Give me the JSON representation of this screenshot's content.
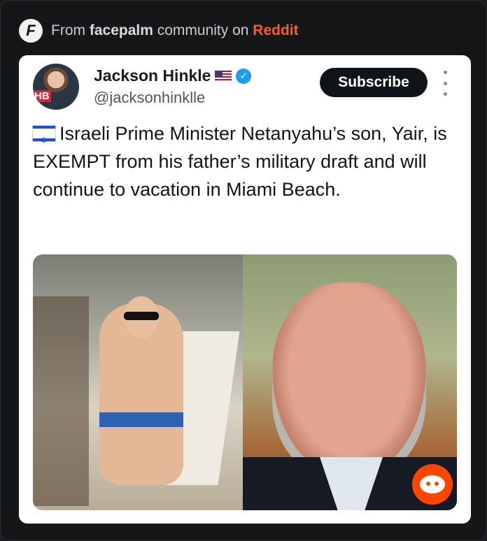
{
  "source": {
    "prefix": "From",
    "community": "facepalm",
    "middle": "community on",
    "platform": "Reddit",
    "logo_letter": "F"
  },
  "post": {
    "author_name": "Jackson Hinkle",
    "author_handle": "@jacksonhinklle",
    "avatar_badge": "HB",
    "subscribe_label": "Subscribe",
    "text": "Israeli Prime Minister Netanyahu’s son, Yair, is EXEMPT from his father’s military draft and will continue to vacation in Miami Beach."
  },
  "icons": {
    "logo": "facepalm-logo-icon",
    "flag": "us-flag-icon",
    "verified": "verified-badge-icon",
    "more": "more-options-icon",
    "text_flag": "israel-flag-icon",
    "reddit": "reddit-snoo-icon"
  },
  "colors": {
    "background": "#141618",
    "reddit_accent": "#ff5a2b",
    "verified_blue": "#1d9bf0",
    "subscribe_bg": "#0f1419"
  }
}
